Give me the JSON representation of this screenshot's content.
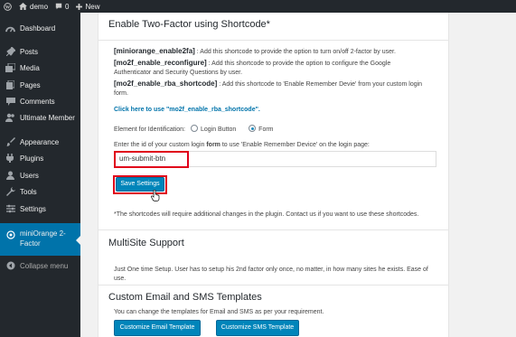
{
  "adminbar": {
    "site_name": "demo",
    "comment_count": "0",
    "new_label": "New"
  },
  "sidebar": {
    "items": [
      {
        "label": "Dashboard",
        "icon": "dashboard-icon"
      },
      {
        "label": "Posts",
        "icon": "pin-icon"
      },
      {
        "label": "Media",
        "icon": "media-icon"
      },
      {
        "label": "Pages",
        "icon": "page-icon"
      },
      {
        "label": "Comments",
        "icon": "comment-icon"
      },
      {
        "label": "Ultimate Member",
        "icon": "users-icon"
      },
      {
        "label": "Appearance",
        "icon": "brush-icon"
      },
      {
        "label": "Plugins",
        "icon": "plugin-icon"
      },
      {
        "label": "Users",
        "icon": "user-icon"
      },
      {
        "label": "Tools",
        "icon": "wrench-icon"
      },
      {
        "label": "Settings",
        "icon": "settings-icon"
      }
    ],
    "active_item": {
      "line1": "miniOrange 2-",
      "line2": "Factor",
      "icon": "shield-icon"
    },
    "collapse_label": "Collapse menu"
  },
  "main": {
    "shortcode_heading": "Enable Two-Factor using Shortcode*",
    "shortcodes": [
      {
        "code": "[miniorange_enable2fa]",
        "desc": ": Add this shortcode to provide the option to turn on/off 2-factor by user."
      },
      {
        "code": "[mo2f_enable_reconfigure]",
        "desc": ": Add this shortcode to provide the option to configure the Google",
        "desc2": "Authenticator and Security Questions by user."
      },
      {
        "code": "[mo2f_enable_rba_shortcode]",
        "desc": ": Add this shortcode to 'Enable Remember Devie' from your custom login",
        "desc2": "form."
      }
    ],
    "use_link": "Click here to use \"mo2f_enable_rba_shortcode\".",
    "identification": {
      "label": "Element for Identification:",
      "options": [
        "Login Button",
        "Form"
      ],
      "selected": "Form"
    },
    "id_prompt": {
      "before": "Enter the id of your custom login ",
      "bold": "form",
      "after": " to use 'Enable Remember Device' on the login page:"
    },
    "id_value": "um-submit-btn",
    "save_label": "Save Settings",
    "note": "*The shortcodes will require additional changes in the plugin. Contact us if you want to use these shortcodes.",
    "multisite_heading": "MultiSite Support",
    "multisite_text": "Just One time Setup. User has to setup his 2nd factor only once, no matter, in how many sites he exists. Ease of",
    "multisite_text2": "use.",
    "templates_heading": "Custom Email and SMS Templates",
    "templates_text": "You can change the templates for Email and SMS as per your requirement.",
    "email_button": "Customize Email Template",
    "sms_button": "Customize SMS Template"
  },
  "colors": {
    "sidebar_bg": "#23282d",
    "accent": "#0073aa",
    "button": "#0085ba",
    "highlight": "#e0001a"
  }
}
